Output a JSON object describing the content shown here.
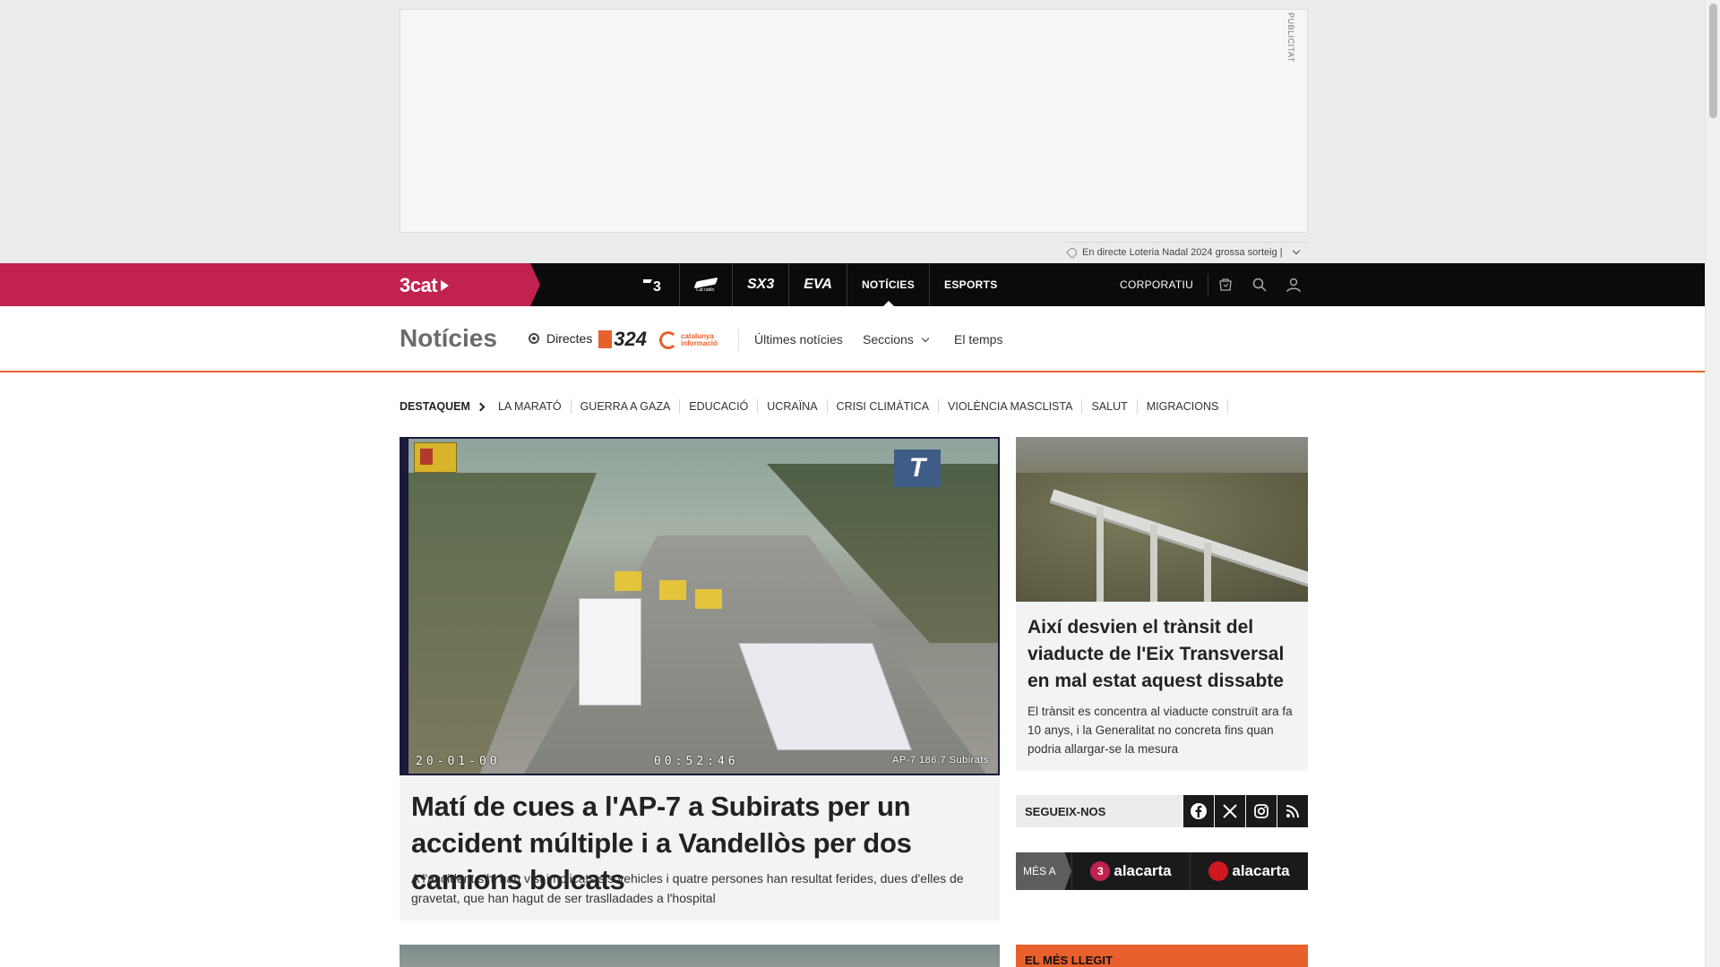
{
  "ad": {
    "label": "PUBLICITAT",
    "ticker_text": "En directe Loteria Nadal 2024 grossa sorteig |"
  },
  "topbar": {
    "brand": "3cat",
    "channels": [
      {
        "label": "3",
        "icon": "tv3-logo"
      },
      {
        "label": "",
        "icon": "catradio-logo"
      },
      {
        "label": "SX3",
        "icon": "sx3-logo"
      },
      {
        "label": "EVA",
        "icon": "eva-logo"
      },
      {
        "label": "NOTÍCIES"
      },
      {
        "label": "ESPORTS"
      }
    ],
    "corporate": "CORPORATIU",
    "icons": [
      "shop-icon",
      "search-icon",
      "user-icon"
    ]
  },
  "section": {
    "title": "Notícies",
    "directes": "Directes",
    "logo324": "324",
    "logo_ci": "catalunya informació",
    "links": [
      "Últimes notícies",
      "Seccions",
      "El temps"
    ]
  },
  "highlights": {
    "title": "DESTAQUEM",
    "items": [
      "LA MARATÓ",
      "GUERRA A GAZA",
      "EDUCACIÓ",
      "UCRAÏNA",
      "CRISI CLIMÀTICA",
      "VIOLÈNCIA MASCLISTA",
      "SALUT",
      "MIGRACIONS"
    ]
  },
  "main_story": {
    "cam_date": "20-01-00",
    "cam_time": "00:52:46",
    "cam_location": "AP-7 186.7 Subirats",
    "title": "Matí de cues a l'AP-7 a Subirats per un accident múltiple i a Vandellòs per dos camions bolcats",
    "description": "A l'accident s'hi han vist implicats sis vehicles i quatre persones han resultat ferides, dues d'elles de gravetat, que han hagut de ser traslladades a l'hospital"
  },
  "side_story": {
    "title": "Així desvien el trànsit del viaducte de l'Eix Transversal en mal estat aquest dissabte",
    "description": "El trànsit es concentra al viaducte construït ara fa 10 anys, i la Generalitat no concreta fins quan podria allargar-se la mesura"
  },
  "follow": {
    "label": "SEGUEIX-NOS",
    "networks": [
      "facebook-icon",
      "x-icon",
      "instagram-icon",
      "rss-icon"
    ]
  },
  "more": {
    "label": "MÉS A",
    "items": [
      {
        "mark": "3",
        "text": "alacarta"
      },
      {
        "mark": "",
        "text": "alacarta"
      }
    ]
  },
  "most_read": {
    "title": "EL MÉS LLEGIT"
  },
  "colors": {
    "brand": "#c1224f",
    "accent": "#e8602c",
    "topbar": "#0b0b0b"
  }
}
